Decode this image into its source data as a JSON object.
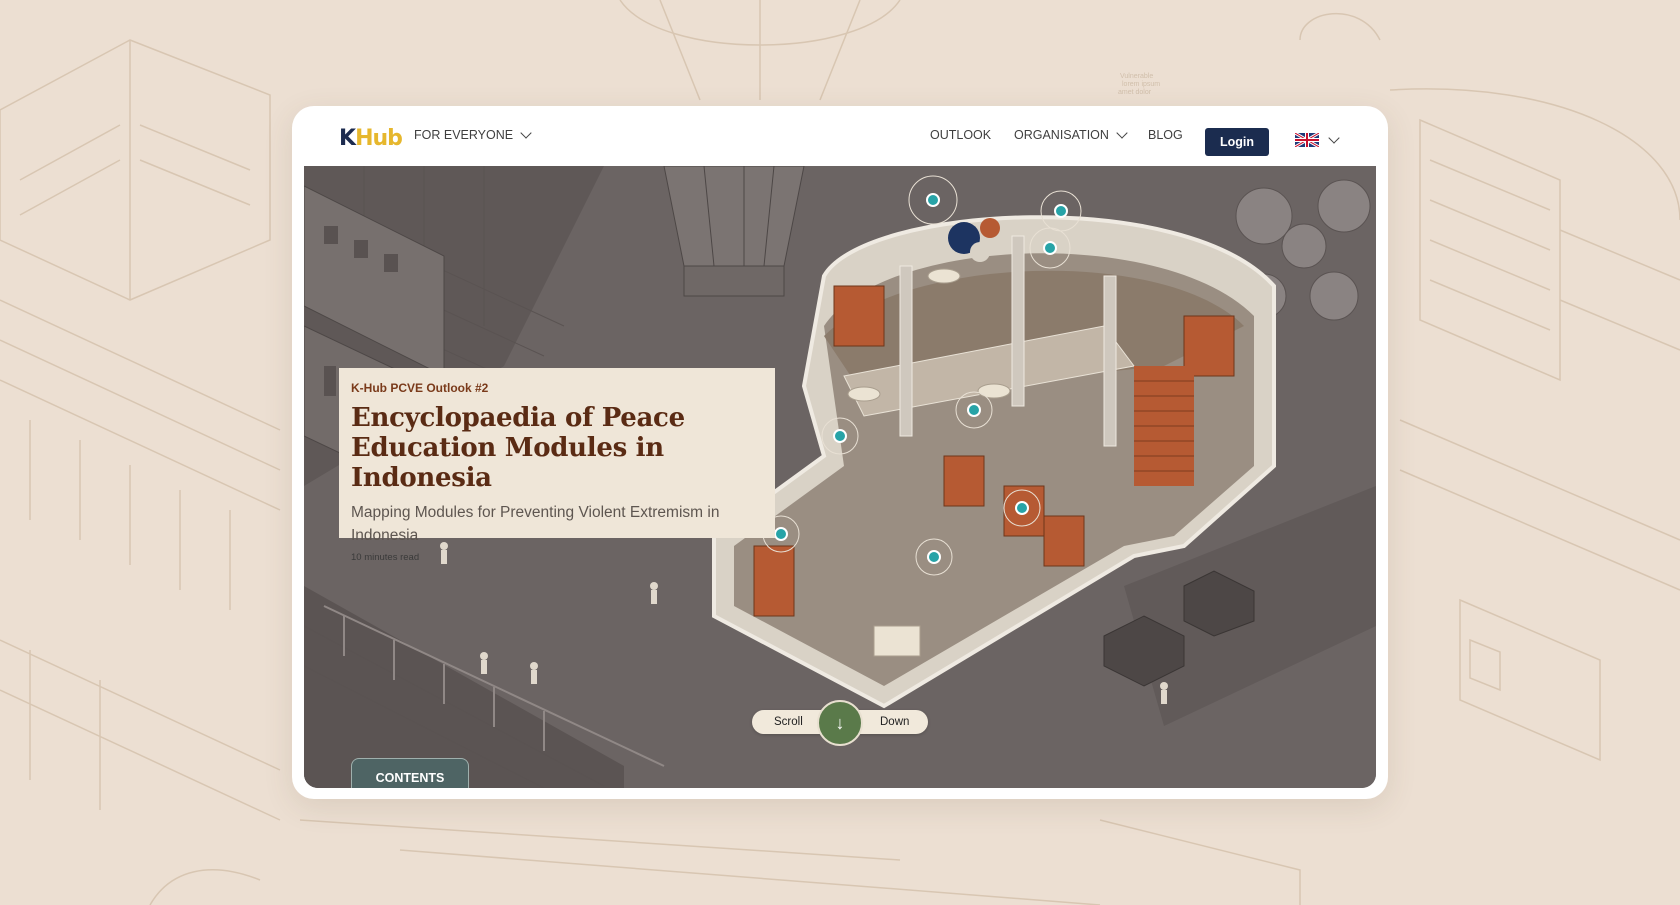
{
  "brand": {
    "logo_k": "K",
    "logo_rest": "Hub"
  },
  "nav": {
    "audience": "FOR EVERYONE",
    "outlook": "OUTLOOK",
    "organisation": "ORGANISATION",
    "blog": "BLOG",
    "login": "Login",
    "language_icon": "uk-flag-icon"
  },
  "hero": {
    "eyebrow": "K-Hub PCVE Outlook #2",
    "title": "Encyclopaedia of Peace Education Modules in Indonesia",
    "subtitle": "Mapping Modules for Preventing Violent Extremism in Indonesia",
    "read_time": "10 minutes read",
    "hotspot_count": 8,
    "hotspot_color": "#27a3a7"
  },
  "scroll": {
    "left": "Scroll",
    "right": "Down",
    "icon": "arrow-down-icon"
  },
  "contents_tab": "CONTENTS",
  "colors": {
    "page_bg": "#ecdfd2",
    "brand_navy": "#1b2c4f",
    "brand_yellow": "#e6b72d",
    "card_bg": "#efe6d8",
    "title_brown": "#5a2b14",
    "scroll_green": "#5a7a4a",
    "contents_teal": "#4e6464"
  }
}
